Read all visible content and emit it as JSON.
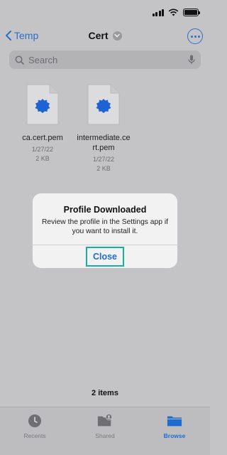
{
  "colors": {
    "accent": "#1f6bd0",
    "highlight": "#17b09c",
    "cert_badge": "#1e63d6"
  },
  "nav": {
    "back_label": "Temp",
    "title": "Cert"
  },
  "search": {
    "placeholder": "Search"
  },
  "files": [
    {
      "name": "ca.cert.pem",
      "date": "1/27/22",
      "size": "2 KB",
      "icon": "certificate-file-icon"
    },
    {
      "name": "intermediate.cert.pem",
      "name_line1": "intermediate.ce",
      "name_line2": "rt.pem",
      "date": "1/27/22",
      "size": "2 KB",
      "icon": "certificate-file-icon"
    }
  ],
  "alert": {
    "title": "Profile Downloaded",
    "message": "Review the profile in the Settings app if you want to install it.",
    "button": "Close"
  },
  "item_count": "2 items",
  "tabs": [
    {
      "label": "Recents",
      "icon": "clock-icon",
      "active": false
    },
    {
      "label": "Shared",
      "icon": "shared-folder-icon",
      "active": false
    },
    {
      "label": "Browse",
      "icon": "folder-icon",
      "active": true
    }
  ]
}
